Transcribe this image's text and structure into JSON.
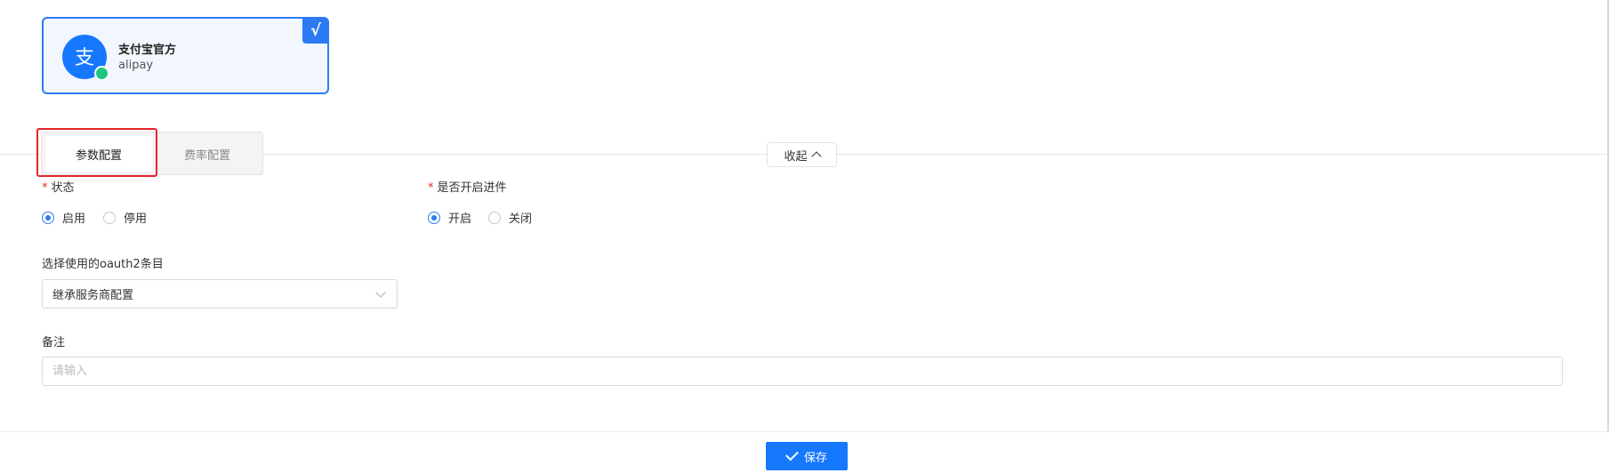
{
  "payment_card": {
    "name": "支付宝官方",
    "code": "alipay",
    "selected_mark": "√",
    "logo_glyph": "支",
    "logo_icon": "alipay-logo-icon",
    "brand_color": "#1677ff",
    "status_color": "#1fc482"
  },
  "tabs": [
    {
      "label": "参数配置",
      "active": true
    },
    {
      "label": "费率配置",
      "active": false
    }
  ],
  "collapse": {
    "label": "收起",
    "icon": "chevron-up-icon"
  },
  "form": {
    "status": {
      "label": "状态",
      "required_mark": "*",
      "options": [
        {
          "label": "启用",
          "checked": true
        },
        {
          "label": "停用",
          "checked": false
        }
      ]
    },
    "incoming": {
      "label": "是否开启进件",
      "required_mark": "*",
      "options": [
        {
          "label": "开启",
          "checked": true
        },
        {
          "label": "关闭",
          "checked": false
        }
      ]
    },
    "oauth": {
      "label": "选择使用的oauth2条目",
      "selected_value": "继承服务商配置"
    },
    "remark": {
      "label": "备注",
      "placeholder": "请输入",
      "value": ""
    }
  },
  "footer": {
    "save_label": "保存",
    "save_icon": "check-icon"
  },
  "colors": {
    "accent": "#2d7bf4",
    "highlight_border": "#e8262a"
  }
}
